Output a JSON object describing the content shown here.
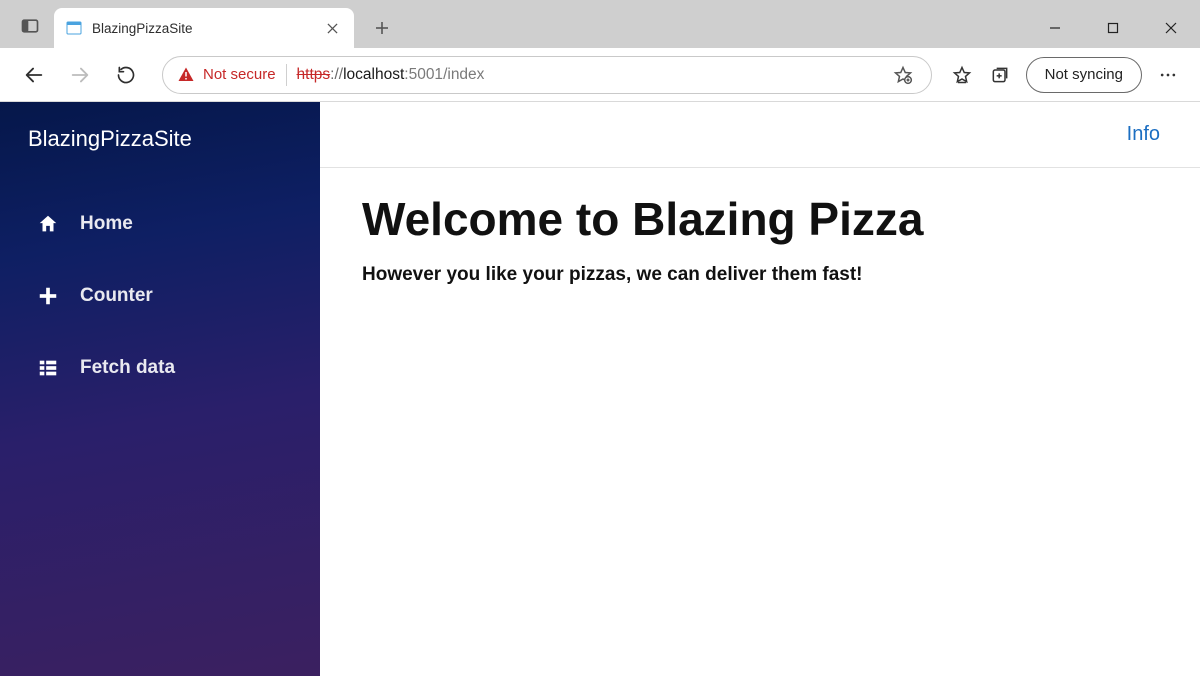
{
  "browser": {
    "tab_title": "BlazingPizzaSite",
    "not_secure_label": "Not secure",
    "url": {
      "scheme": "https",
      "after_scheme": "://",
      "host": "localhost",
      "port": ":5001",
      "path": "/index"
    },
    "sync_label": "Not syncing"
  },
  "sidebar": {
    "brand": "BlazingPizzaSite",
    "items": [
      {
        "label": "Home"
      },
      {
        "label": "Counter"
      },
      {
        "label": "Fetch data"
      }
    ]
  },
  "topbar": {
    "info_label": "Info"
  },
  "page": {
    "heading": "Welcome to Blazing Pizza",
    "subtext": "However you like your pizzas, we can deliver them fast!"
  }
}
